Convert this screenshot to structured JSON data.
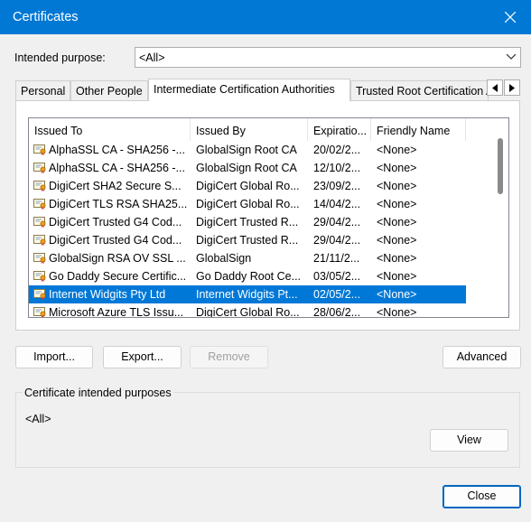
{
  "window": {
    "title": "Certificates"
  },
  "purpose": {
    "label": "Intended purpose:",
    "value": "<All>"
  },
  "tabs": [
    {
      "label": "Personal"
    },
    {
      "label": "Other People"
    },
    {
      "label": "Intermediate Certification Authorities",
      "active": true
    },
    {
      "label": "Trusted Root Certification Authorities"
    }
  ],
  "table": {
    "columns": [
      "Issued To",
      "Issued By",
      "Expiratio...",
      "Friendly Name"
    ],
    "rows": [
      {
        "issued_to": "AlphaSSL CA - SHA256 -...",
        "issued_by": "GlobalSign Root CA",
        "expiration": "20/02/2...",
        "friendly_name": "<None>"
      },
      {
        "issued_to": "AlphaSSL CA - SHA256 -...",
        "issued_by": "GlobalSign Root CA",
        "expiration": "12/10/2...",
        "friendly_name": "<None>"
      },
      {
        "issued_to": "DigiCert SHA2 Secure S...",
        "issued_by": "DigiCert Global Ro...",
        "expiration": "23/09/2...",
        "friendly_name": "<None>"
      },
      {
        "issued_to": "DigiCert TLS RSA SHA25...",
        "issued_by": "DigiCert Global Ro...",
        "expiration": "14/04/2...",
        "friendly_name": "<None>"
      },
      {
        "issued_to": "DigiCert Trusted G4 Cod...",
        "issued_by": "DigiCert Trusted R...",
        "expiration": "29/04/2...",
        "friendly_name": "<None>"
      },
      {
        "issued_to": "DigiCert Trusted G4 Cod...",
        "issued_by": "DigiCert Trusted R...",
        "expiration": "29/04/2...",
        "friendly_name": "<None>"
      },
      {
        "issued_to": "GlobalSign RSA OV SSL ...",
        "issued_by": "GlobalSign",
        "expiration": "21/11/2...",
        "friendly_name": "<None>"
      },
      {
        "issued_to": "Go Daddy Secure Certific...",
        "issued_by": "Go Daddy Root Ce...",
        "expiration": "03/05/2...",
        "friendly_name": "<None>"
      },
      {
        "issued_to": "Internet Widgits Pty Ltd",
        "issued_by": "Internet Widgits Pt...",
        "expiration": "02/05/2...",
        "friendly_name": "<None>",
        "selected": true
      },
      {
        "issued_to": "Microsoft Azure TLS Issu...",
        "issued_by": "DigiCert Global Ro...",
        "expiration": "28/06/2...",
        "friendly_name": "<None>"
      }
    ]
  },
  "buttons": {
    "import": "Import...",
    "export": "Export...",
    "remove": "Remove",
    "advanced": "Advanced",
    "view": "View",
    "close": "Close"
  },
  "purposes_group": {
    "title": "Certificate intended purposes",
    "value": "<All>"
  },
  "colors": {
    "titlebar": "#0078d4",
    "selection": "#0078d7",
    "accent_border": "#0067c0"
  },
  "icons": [
    "close-icon",
    "chevron-down-icon",
    "chevron-left-icon",
    "chevron-right-icon",
    "certificate-icon"
  ]
}
